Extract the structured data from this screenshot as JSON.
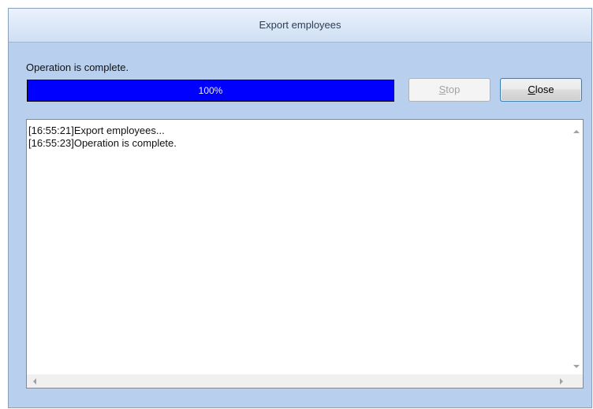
{
  "window": {
    "title": "Export employees"
  },
  "status": {
    "text": "Operation is complete."
  },
  "progress": {
    "value_percent": 100,
    "label": "100%",
    "fill_color": "#0000ff"
  },
  "buttons": {
    "stop": {
      "label_underlined": "S",
      "label_rest": "top",
      "enabled": false
    },
    "close": {
      "label_underlined": "C",
      "label_rest": "lose",
      "enabled": true
    }
  },
  "log": {
    "lines": [
      "[16:55:21]Export employees...",
      "[16:55:23]Operation is complete."
    ]
  },
  "icons": {
    "scroll_up": "chevron-up-icon",
    "scroll_down": "chevron-down-icon",
    "scroll_left": "chevron-left-icon",
    "scroll_right": "chevron-right-icon"
  }
}
